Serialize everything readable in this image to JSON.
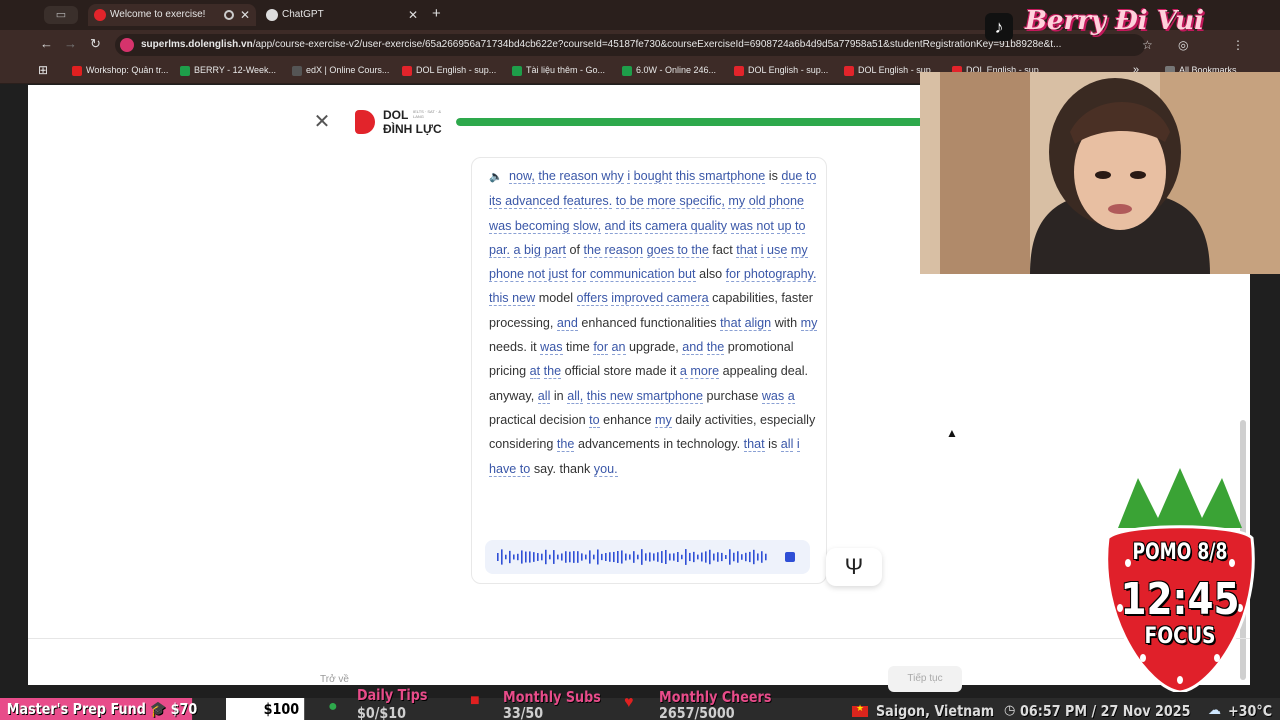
{
  "browser": {
    "tabs": [
      {
        "title": "Welcome to exercise!",
        "active": true
      },
      {
        "title": "ChatGPT",
        "active": false
      }
    ],
    "url_domain": "superlms.dolenglish.vn",
    "url_path": "/app/course-exercise-v2/user-exercise/65a266956a71734bd4cb622e?courseId=45187fe730&courseExerciseId=6908724a6b4d9d5a77958a51&studentRegistrationKey=91b8928e&t...",
    "bookmarks": [
      {
        "label": "Workshop: Quản tr...",
        "color": "#e02020"
      },
      {
        "label": "BERRY - 12-Week...",
        "color": "#1e9e4a"
      },
      {
        "label": "edX | Online Cours...",
        "color": "#555555"
      },
      {
        "label": "DOL English - sup...",
        "color": "#e2242b"
      },
      {
        "label": "Tài liệu thêm - Go...",
        "color": "#1e9e4a"
      },
      {
        "label": "6.0W - Online 246...",
        "color": "#1e9e4a"
      },
      {
        "label": "DOL English - sup...",
        "color": "#e2242b"
      },
      {
        "label": "DOL English - sup...",
        "color": "#e2242b"
      },
      {
        "label": "DOL English - sup...",
        "color": "#e2242b"
      }
    ],
    "all_bookmarks_label": "All Bookmarks"
  },
  "overlay": {
    "channel_title": "Berry Đi Vui",
    "pomo_label": "POMO 8/8",
    "timer": "12:45",
    "mode": "FOCUS"
  },
  "lesson": {
    "brand_line1": "DOL",
    "brand_tag": "IELTS · SAT · & LANG",
    "brand_line2": "ĐÌNH LỰC",
    "progress": 1.0,
    "back_label": "Trở về",
    "next_label": "Tiếp tục",
    "transcript": [
      {
        "t": "now,",
        "u": true
      },
      {
        "t": "the reason why",
        "u": true
      },
      {
        "t": "i",
        "u": true
      },
      {
        "t": "bought",
        "u": true
      },
      {
        "t": "this smartphone",
        "u": true
      },
      {
        "t": "is",
        "u": false
      },
      {
        "t": "due to",
        "u": true
      },
      {
        "t": "its advanced features.",
        "u": true
      },
      {
        "t": "to be more specific,",
        "u": true
      },
      {
        "t": "my old phone",
        "u": true
      },
      {
        "t": "was becoming",
        "u": true
      },
      {
        "t": "slow,",
        "u": true
      },
      {
        "t": "and its",
        "u": true
      },
      {
        "t": "camera quality",
        "u": true
      },
      {
        "t": "was not",
        "u": true
      },
      {
        "t": "up to par.",
        "u": true
      },
      {
        "t": "a big part",
        "u": true
      },
      {
        "t": "of",
        "u": false
      },
      {
        "t": "the reason",
        "u": true
      },
      {
        "t": "goes to the",
        "u": true
      },
      {
        "t": "fact",
        "u": false
      },
      {
        "t": "that",
        "u": true
      },
      {
        "t": "i",
        "u": true
      },
      {
        "t": "use",
        "u": true
      },
      {
        "t": "my phone",
        "u": true
      },
      {
        "t": "not just",
        "u": true
      },
      {
        "t": "for",
        "u": true
      },
      {
        "t": "communication",
        "u": true
      },
      {
        "t": "but",
        "u": true
      },
      {
        "t": "also",
        "u": false
      },
      {
        "t": "for photography.",
        "u": true
      },
      {
        "t": "this new",
        "u": true
      },
      {
        "t": "model",
        "u": false
      },
      {
        "t": "offers",
        "u": true
      },
      {
        "t": "improved camera",
        "u": true
      },
      {
        "t": "capabilities,",
        "u": false
      },
      {
        "t": "faster processing,",
        "u": false
      },
      {
        "t": "and",
        "u": true
      },
      {
        "t": "enhanced functionalities",
        "u": false
      },
      {
        "t": "that align",
        "u": true
      },
      {
        "t": "with",
        "u": false
      },
      {
        "t": "my",
        "u": true
      },
      {
        "t": "needs.",
        "u": false
      },
      {
        "t": "it",
        "u": false
      },
      {
        "t": "was",
        "u": true
      },
      {
        "t": "time",
        "u": false
      },
      {
        "t": "for",
        "u": true
      },
      {
        "t": "an",
        "u": true
      },
      {
        "t": "upgrade,",
        "u": false
      },
      {
        "t": "and",
        "u": true
      },
      {
        "t": "the",
        "u": true
      },
      {
        "t": "promotional pricing",
        "u": false
      },
      {
        "t": "at",
        "u": true
      },
      {
        "t": "the",
        "u": true
      },
      {
        "t": "official store",
        "u": false
      },
      {
        "t": "made it",
        "u": false
      },
      {
        "t": "a more",
        "u": true
      },
      {
        "t": "appealing deal.",
        "u": false
      },
      {
        "t": "anyway,",
        "u": false
      },
      {
        "t": "all",
        "u": true
      },
      {
        "t": "in",
        "u": false
      },
      {
        "t": "all,",
        "u": true
      },
      {
        "t": "this new smartphone",
        "u": true
      },
      {
        "t": "purchase",
        "u": false
      },
      {
        "t": "was",
        "u": true
      },
      {
        "t": "a",
        "u": true
      },
      {
        "t": "practical decision",
        "u": false
      },
      {
        "t": "to",
        "u": true
      },
      {
        "t": "enhance",
        "u": false
      },
      {
        "t": "my",
        "u": true
      },
      {
        "t": "daily activities,",
        "u": false
      },
      {
        "t": "especially considering",
        "u": false
      },
      {
        "t": "the",
        "u": true
      },
      {
        "t": "advancements in",
        "u": false
      },
      {
        "t": "technology.",
        "u": false
      },
      {
        "t": "that",
        "u": true
      },
      {
        "t": "is",
        "u": false
      },
      {
        "t": "all",
        "u": true
      },
      {
        "t": "i",
        "u": true
      },
      {
        "t": "have to",
        "u": true
      },
      {
        "t": "say.",
        "u": false
      },
      {
        "t": "thank",
        "u": false
      },
      {
        "t": "you.",
        "u": true
      }
    ]
  },
  "ticker": {
    "fund": "Master's Prep Fund 🎓 $70",
    "fund_goal": "$100",
    "items": [
      {
        "label": "Daily Tips",
        "value": "$0/$10"
      },
      {
        "label": "Monthly Subs",
        "value": "33/50"
      },
      {
        "label": "Monthly Cheers",
        "value": "2657/5000"
      }
    ],
    "location": "Saigon, Vietnam",
    "clock": "06:57 PM / 27 Nov 2025",
    "weather": "+30°C"
  },
  "colors": {
    "accent_green": "#2ea94c",
    "link_blue": "#3a57a8",
    "brand_red": "#e2242b",
    "ticker_pink": "#e84c8a"
  }
}
